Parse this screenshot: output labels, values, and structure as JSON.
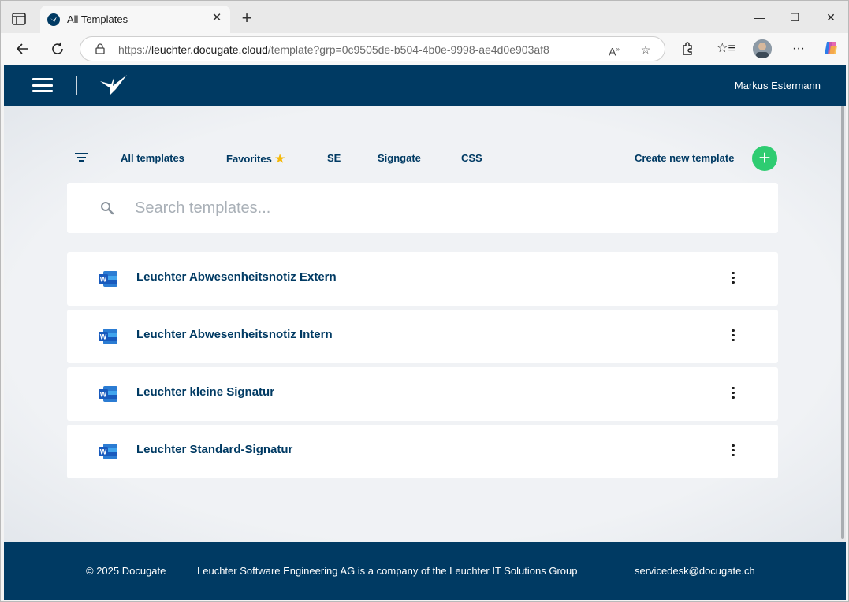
{
  "browser": {
    "tab_title": "All Templates",
    "url_prefix": "https://",
    "url_host": "leuchter.docugate.cloud",
    "url_path": "/template?grp=0c9505de-b504-4b0e-9998-ae4d0e903af8"
  },
  "header": {
    "username": "Markus Estermann"
  },
  "nav": {
    "items": [
      {
        "label": "All templates"
      },
      {
        "label": "Favorites"
      },
      {
        "label": "SE"
      },
      {
        "label": "Signgate"
      },
      {
        "label": "CSS"
      }
    ],
    "create_label": "Create new template"
  },
  "search": {
    "placeholder": "Search templates..."
  },
  "templates": [
    {
      "title": "Leuchter Abwesenheitsnotiz Extern",
      "icon": "word-icon"
    },
    {
      "title": "Leuchter Abwesenheitsnotiz Intern",
      "icon": "word-icon"
    },
    {
      "title": "Leuchter kleine Signatur",
      "icon": "word-icon"
    },
    {
      "title": "Leuchter Standard-Signatur",
      "icon": "word-icon"
    }
  ],
  "footer": {
    "copyright": "© 2025 Docugate",
    "company": "Leuchter Software Engineering AG is a company of the Leuchter IT Solutions Group",
    "email": "servicedesk@docugate.ch"
  },
  "colors": {
    "brand": "#003a63",
    "accent": "#2ecc71",
    "star": "#f5b90b"
  }
}
